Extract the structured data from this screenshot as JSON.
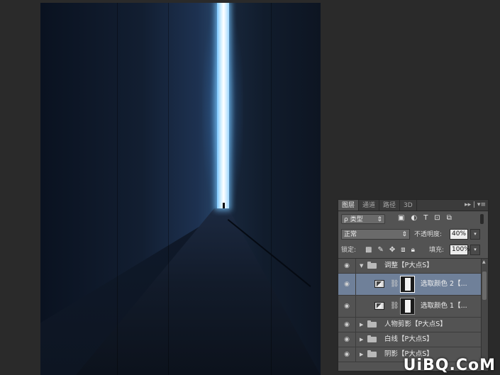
{
  "panel": {
    "tabs": [
      "图层",
      "通道",
      "路径",
      "3D"
    ],
    "tab_tools": "▸▸ | ▾≡",
    "filter_label": "ρ 类型",
    "filter_icons": [
      "image-filter-icon",
      "adjustment-filter-icon",
      "type-filter-icon",
      "shape-filter-icon",
      "smart-object-filter-icon"
    ],
    "blend_mode": "正常",
    "opacity_label": "不透明度:",
    "opacity_value": "40%",
    "lock_label": "锁定:",
    "lock_icons": [
      "lock-transparent-icon",
      "lock-image-icon",
      "lock-position-icon",
      "lock-artboard-icon",
      "lock-all-icon"
    ],
    "fill_label": "填充:",
    "fill_value": "100%"
  },
  "layers": [
    {
      "name": "调整【P大点S】",
      "type": "group",
      "expanded": true
    },
    {
      "name": "选取颜色 2【...",
      "type": "adjustment",
      "selected": true
    },
    {
      "name": "选取颜色 1【...",
      "type": "adjustment",
      "selected": false
    },
    {
      "name": "人物剪影【P大点S】",
      "type": "group",
      "expanded": false
    },
    {
      "name": "白线【P大点S】",
      "type": "group",
      "expanded": false
    },
    {
      "name": "阴影【P大点S】",
      "type": "group",
      "expanded": false
    }
  ],
  "watermark": "UiBQ.CoM",
  "colors": {
    "panel_bg": "#535353",
    "selected_row": "#6f8099",
    "glow": "#d8f2ff"
  }
}
